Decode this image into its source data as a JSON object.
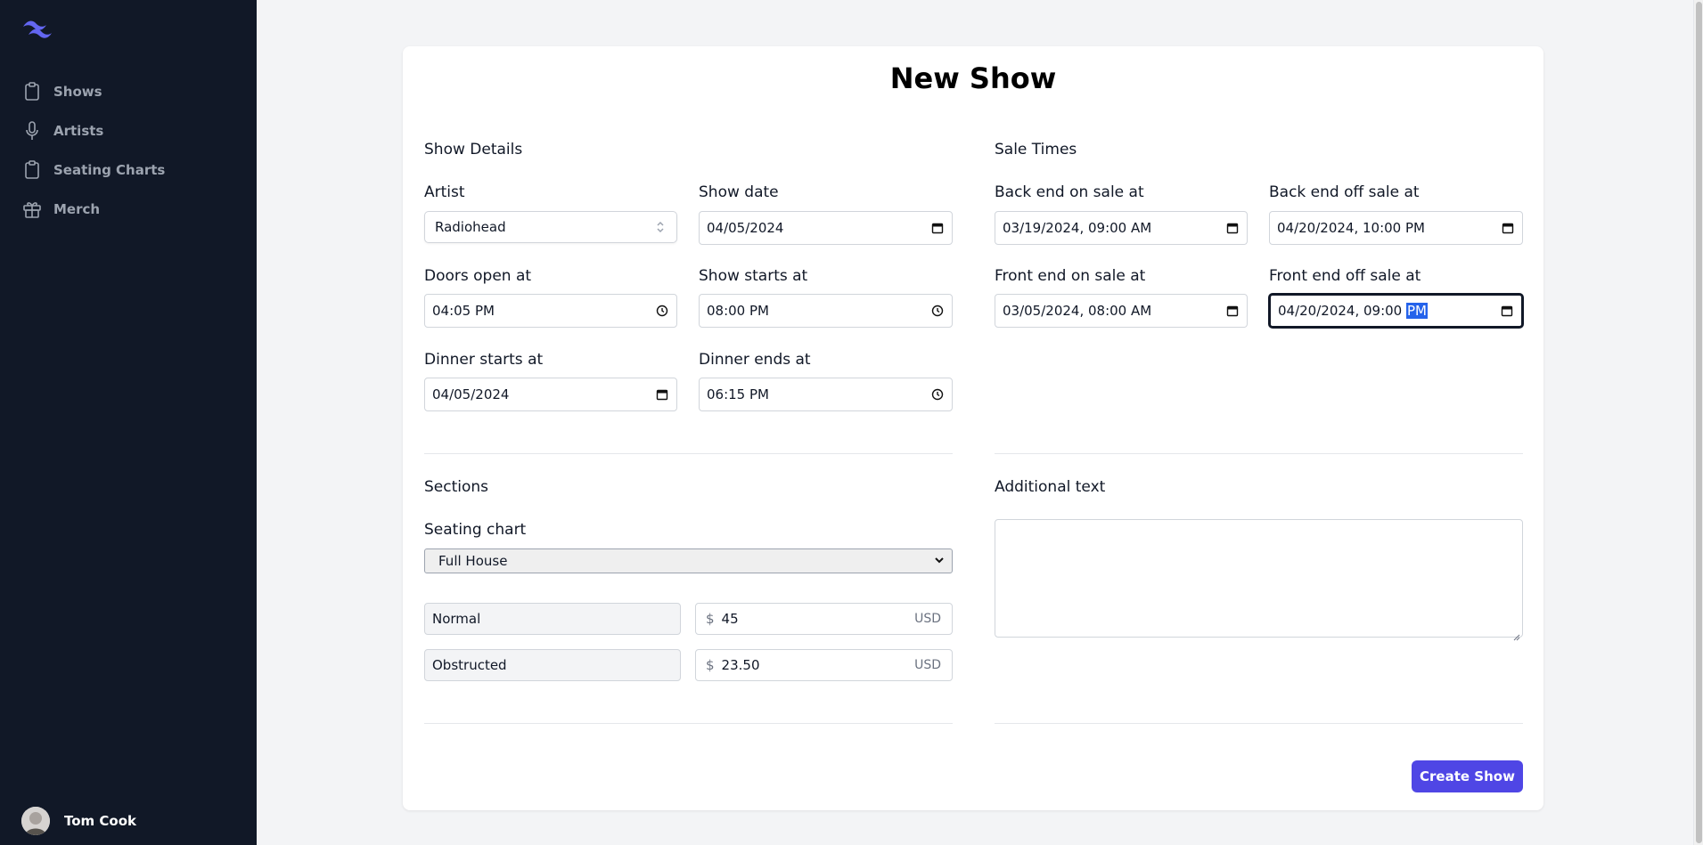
{
  "sidebar": {
    "logo": "tailwind-logo",
    "items": [
      {
        "label": "Shows",
        "icon": "clipboard-icon"
      },
      {
        "label": "Artists",
        "icon": "microphone-icon"
      },
      {
        "label": "Seating Charts",
        "icon": "clipboard-icon"
      },
      {
        "label": "Merch",
        "icon": "gift-icon"
      }
    ],
    "user": {
      "name": "Tom Cook"
    }
  },
  "page": {
    "title": "New Show"
  },
  "show_details": {
    "heading": "Show Details",
    "artist_label": "Artist",
    "artist_value": "Radiohead",
    "show_date_label": "Show date",
    "show_date_value": "04/05/2024",
    "doors_label": "Doors open at",
    "doors_value": "04:05 PM",
    "show_starts_label": "Show starts at",
    "show_starts_value": "08:00 PM",
    "dinner_starts_label": "Dinner starts at",
    "dinner_starts_value": "04/05/2024",
    "dinner_ends_label": "Dinner ends at",
    "dinner_ends_value": "06:15 PM"
  },
  "sale_times": {
    "heading": "Sale Times",
    "back_on_label": "Back end on sale at",
    "back_on_value": "03/19/2024, 09:00 AM",
    "back_off_label": "Back end off sale at",
    "back_off_value": "04/20/2024, 10:00 PM",
    "front_on_label": "Front end on sale at",
    "front_on_value": "03/05/2024, 08:00 AM",
    "front_off_label": "Front end off sale at",
    "front_off_value_main": "04/20/2024, 09:00 ",
    "front_off_value_selected": "PM"
  },
  "sections": {
    "heading": "Sections",
    "seating_chart_label": "Seating chart",
    "seating_chart_value": "Full House",
    "tiers": [
      {
        "name": "Normal",
        "currency_symbol": "$",
        "price": "45",
        "currency": "USD"
      },
      {
        "name": "Obstructed",
        "currency_symbol": "$",
        "price": "23.50",
        "currency": "USD"
      }
    ]
  },
  "additional": {
    "heading": "Additional text",
    "value": ""
  },
  "actions": {
    "create_label": "Create Show"
  },
  "colors": {
    "sidebar_bg": "#111827",
    "accent": "#4f46e5",
    "page_bg": "#f3f4f6"
  }
}
